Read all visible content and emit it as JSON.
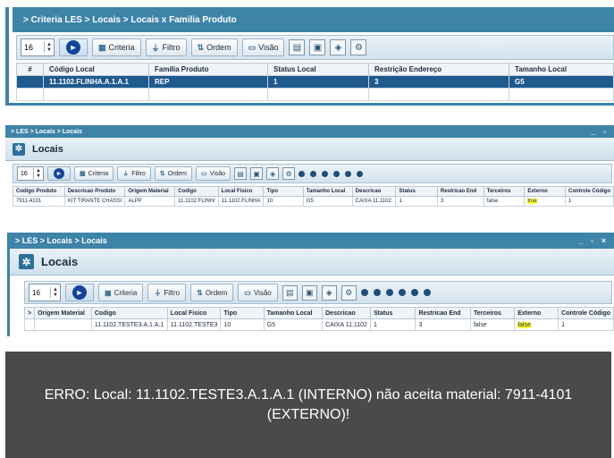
{
  "panel1": {
    "breadcrumb": "> Criteria LES > Locais > Locais x Familia Produto",
    "toolbar": {
      "page_size": "16",
      "criteria": "Criteria",
      "filtro": "Filtro",
      "ordem": "Ordem",
      "visao": "Visão"
    },
    "columns": [
      "#",
      "Código Local",
      "Família Produto",
      "Status Local",
      "Restrição Endereço",
      "Tamanho Local"
    ],
    "row": [
      "",
      "11.1102.FLINHA.A.1.A.1",
      "REP",
      "1",
      "3",
      "G5"
    ]
  },
  "panel2": {
    "breadcrumb": "> LES > Locais > Locais",
    "window_controls": "_ ▫",
    "title": "Locais",
    "toolbar": {
      "page_size": "16",
      "criteria": "Criteria",
      "filtro": "Filtro",
      "ordem": "Ordem",
      "visao": "Visão"
    },
    "columns": [
      "Codigo Produto",
      "Descricao Produto",
      "Origem Material",
      "Codigo",
      "Local Fisico",
      "Tipo",
      "Tamanho Local",
      "Descricao",
      "Status",
      "Restricao End",
      "Terceiros",
      "Externo",
      "Controle Código"
    ],
    "row": [
      "7911-4101",
      "KIT TIRANTE CHASSI",
      "ALPP",
      "11.1102.FLINH/",
      "11.1102.FLINHA",
      "10",
      "G5",
      "CAIXA 11.1102.",
      "1",
      "3",
      "false",
      "true",
      "1"
    ]
  },
  "panel3": {
    "breadcrumb": "> LES > Locais > Locais",
    "window_controls": "_ ▫ ×",
    "title": "Locais",
    "toolbar": {
      "page_size": "16",
      "criteria": "Criteria",
      "filtro": "Filtro",
      "ordem": "Ordem",
      "visao": "Visão"
    },
    "columns": [
      ">",
      "Origem Material",
      "Codigo",
      "Local Fisico",
      "Tipo",
      "Tamanho Local",
      "Descricao",
      "Status",
      "Restricao End",
      "Terceiros",
      "Externo",
      "Controle Código"
    ],
    "row": [
      "",
      "",
      "11.1102.TESTE3.A.1.A.1",
      "11.1102.TESTE3",
      "10",
      "G5",
      "CAIXA 11.1102",
      "1",
      "3",
      "false",
      "false",
      "1"
    ]
  },
  "error_message": "ERRO: Local: 11.1102.TESTE3.A.1.A.1 (INTERNO) não aceita material: 7911-4101 (EXTERNO)!",
  "colors": {
    "accent": "#3d84a8",
    "selected_row": "#1f5a8e",
    "highlight": "#ffff33",
    "error_bg": "#4a4a4a"
  }
}
